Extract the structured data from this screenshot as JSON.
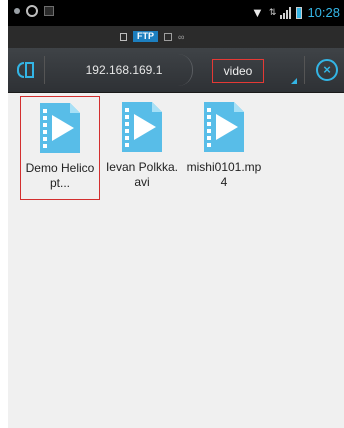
{
  "status_bar": {
    "time": "10:28",
    "icons": [
      "notification-dot-icon",
      "circle-icon",
      "square-icon",
      "wifi-icon",
      "network-icon",
      "signal-icon",
      "battery-icon"
    ]
  },
  "notification_strip": {
    "badge": "FTP"
  },
  "address_bar": {
    "breadcrumbs": [
      "192.168.169.1",
      "video"
    ],
    "accent_color": "#33b5e5"
  },
  "files": [
    {
      "name": "Demo Helicopt...",
      "type": "video",
      "selected": true
    },
    {
      "name": "Ievan Polkka.avi",
      "type": "video",
      "selected": false
    },
    {
      "name": "mishi0101.mp4",
      "type": "video",
      "selected": false
    }
  ],
  "highlight_color": "#d32f2f"
}
